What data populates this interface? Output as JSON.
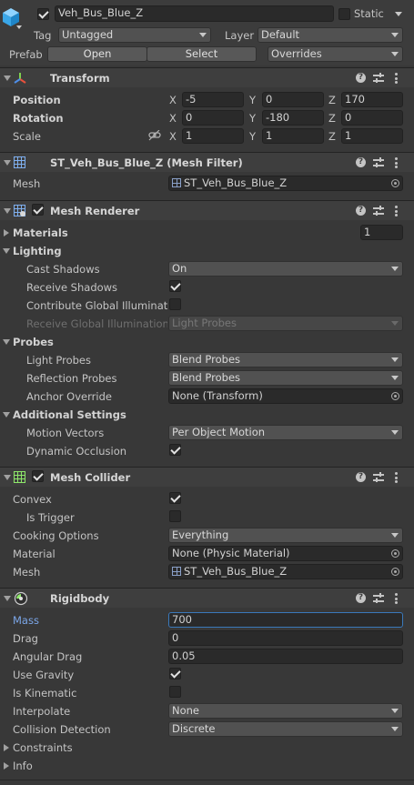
{
  "object": {
    "name": "Veh_Bus_Blue_Z",
    "active": true,
    "static_label": "Static",
    "static_checked": false,
    "tag_label": "Tag",
    "tag_value": "Untagged",
    "layer_label": "Layer",
    "layer_value": "Default",
    "prefab_label": "Prefab",
    "prefab_open": "Open",
    "prefab_select": "Select",
    "prefab_overrides": "Overrides"
  },
  "transform": {
    "title": "Transform",
    "position_label": "Position",
    "rotation_label": "Rotation",
    "scale_label": "Scale",
    "axis_x": "X",
    "axis_y": "Y",
    "axis_z": "Z",
    "position": {
      "x": "-5",
      "y": "0",
      "z": "170"
    },
    "rotation": {
      "x": "0",
      "y": "-180",
      "z": "0"
    },
    "scale": {
      "x": "1",
      "y": "1",
      "z": "1"
    }
  },
  "mesh_filter": {
    "title": "ST_Veh_Bus_Blue_Z (Mesh Filter)",
    "mesh_label": "Mesh",
    "mesh_value": "ST_Veh_Bus_Blue_Z"
  },
  "mesh_renderer": {
    "title": "Mesh Renderer",
    "enabled": true,
    "materials_label": "Materials",
    "materials_count": "1",
    "lighting_label": "Lighting",
    "cast_shadows_label": "Cast Shadows",
    "cast_shadows_value": "On",
    "receive_shadows_label": "Receive Shadows",
    "receive_shadows": true,
    "contribute_gi_label": "Contribute Global Illuminatio",
    "contribute_gi": false,
    "receive_gi_label": "Receive Global Illumination",
    "receive_gi_value": "Light Probes",
    "probes_label": "Probes",
    "light_probes_label": "Light Probes",
    "light_probes_value": "Blend Probes",
    "reflection_probes_label": "Reflection Probes",
    "reflection_probes_value": "Blend Probes",
    "anchor_override_label": "Anchor Override",
    "anchor_override_value": "None (Transform)",
    "additional_label": "Additional Settings",
    "motion_vectors_label": "Motion Vectors",
    "motion_vectors_value": "Per Object Motion",
    "dynamic_occlusion_label": "Dynamic Occlusion",
    "dynamic_occlusion": true
  },
  "mesh_collider": {
    "title": "Mesh Collider",
    "enabled": true,
    "convex_label": "Convex",
    "convex": true,
    "is_trigger_label": "Is Trigger",
    "is_trigger": false,
    "cooking_label": "Cooking Options",
    "cooking_value": "Everything",
    "material_label": "Material",
    "material_value": "None (Physic Material)",
    "mesh_label": "Mesh",
    "mesh_value": "ST_Veh_Bus_Blue_Z"
  },
  "rigidbody": {
    "title": "Rigidbody",
    "mass_label": "Mass",
    "mass_value": "700",
    "drag_label": "Drag",
    "drag_value": "0",
    "angular_drag_label": "Angular Drag",
    "angular_drag_value": "0.05",
    "use_gravity_label": "Use Gravity",
    "use_gravity": true,
    "is_kinematic_label": "Is Kinematic",
    "is_kinematic": false,
    "interpolate_label": "Interpolate",
    "interpolate_value": "None",
    "collision_label": "Collision Detection",
    "collision_value": "Discrete",
    "constraints_label": "Constraints",
    "info_label": "Info"
  },
  "icons": {
    "cube": "gameobject-cube-icon",
    "help": "help-icon",
    "presets": "presets-icon",
    "menu": "kebab-menu-icon",
    "link": "constrain-proportions-icon"
  }
}
